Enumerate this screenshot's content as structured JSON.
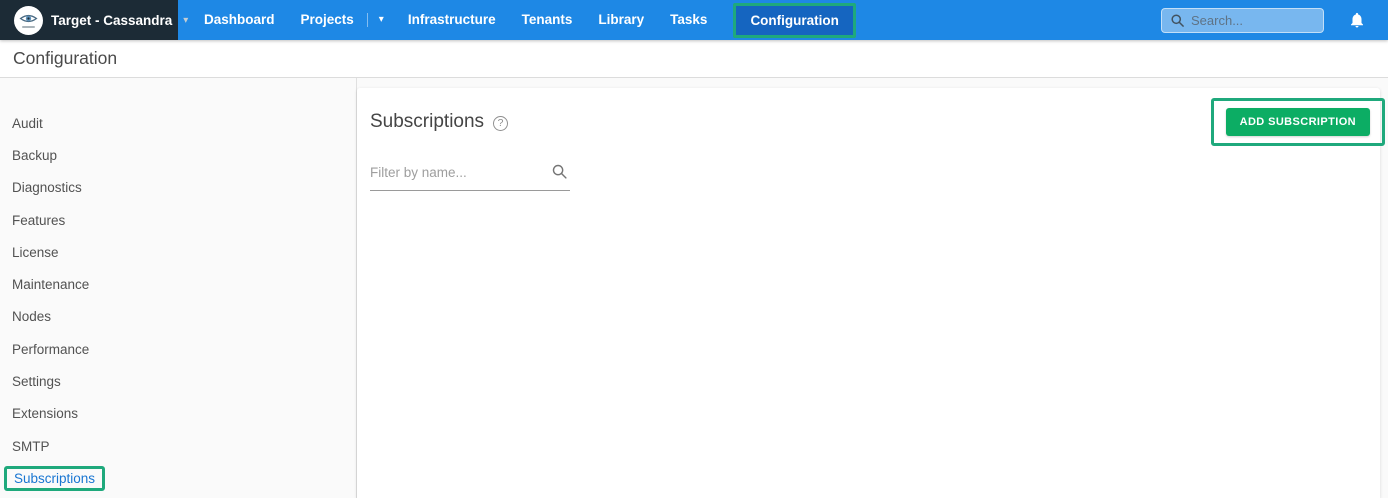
{
  "topbar": {
    "brand": {
      "label": "Target - Cassandra",
      "logo_icon": "cassandra-eye-logo"
    },
    "nav": [
      {
        "label": "Dashboard",
        "active": false
      },
      {
        "label": "Projects",
        "active": false,
        "split_dropdown": true
      },
      {
        "label": "Infrastructure",
        "active": false
      },
      {
        "label": "Tenants",
        "active": false
      },
      {
        "label": "Library",
        "active": false
      },
      {
        "label": "Tasks",
        "active": false
      },
      {
        "label": "Configuration",
        "active": true
      }
    ],
    "search": {
      "placeholder": "Search...",
      "value": ""
    },
    "icons": {
      "search": "magnifier-icon",
      "notifications": "bell-icon"
    }
  },
  "page_header": {
    "title": "Configuration"
  },
  "sidebar": {
    "items": [
      {
        "label": "Audit",
        "active": false
      },
      {
        "label": "Backup",
        "active": false
      },
      {
        "label": "Diagnostics",
        "active": false
      },
      {
        "label": "Features",
        "active": false
      },
      {
        "label": "License",
        "active": false
      },
      {
        "label": "Maintenance",
        "active": false
      },
      {
        "label": "Nodes",
        "active": false
      },
      {
        "label": "Performance",
        "active": false
      },
      {
        "label": "Settings",
        "active": false
      },
      {
        "label": "Extensions",
        "active": false
      },
      {
        "label": "SMTP",
        "active": false
      },
      {
        "label": "Subscriptions",
        "active": true
      }
    ]
  },
  "main": {
    "heading": "Subscriptions",
    "filter": {
      "placeholder": "Filter by name...",
      "value": ""
    },
    "add_button_label": "ADD SUBSCRIPTION",
    "icons": {
      "help": "question-circle-icon",
      "filter_search": "magnifier-icon"
    }
  },
  "glyphs": {
    "caret_down": "▾",
    "help": "?"
  },
  "annotations": {
    "color": "#1FA97C",
    "highlighted_elements": [
      "nav-item-configuration",
      "sidebar-item-subscriptions",
      "add-subscription-button"
    ]
  },
  "colors": {
    "topbar_background": "#1E88E5",
    "brand_background": "#1C2B36",
    "active_nav_background": "#1565C0",
    "annotation_green": "#1FA97C",
    "add_button_green": "#0CAD64",
    "active_sidebar_link": "#1976D2",
    "sidebar_background": "#fafafa",
    "card_background": "#ffffff"
  }
}
